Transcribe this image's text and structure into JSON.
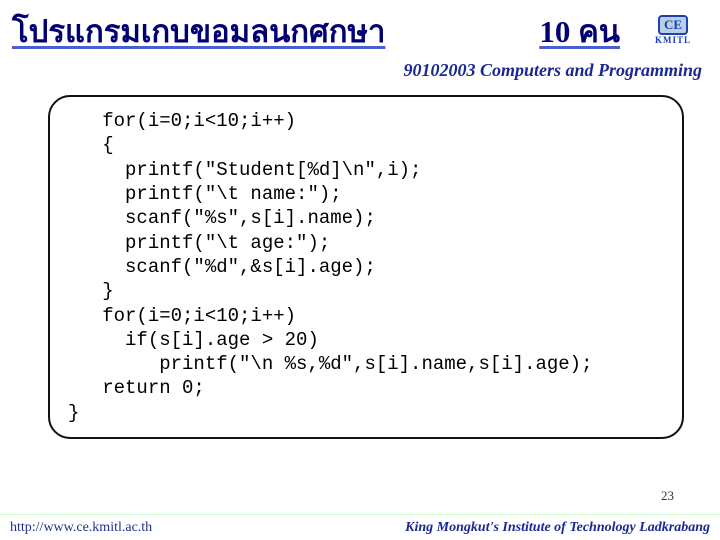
{
  "header": {
    "title_left": "โปรแกรมเกบขอมลนกศกษา",
    "title_right": "10 คน",
    "subheader": "90102003 Computers and Programming",
    "logo_top": "CE",
    "logo_bot": "KMITL"
  },
  "code": {
    "lines": [
      "   for(i=0;i<10;i++)",
      "   {",
      "     printf(\"Student[%d]\\n\",i);",
      "     printf(\"\\t name:\");",
      "     scanf(\"%s\",s[i].name);",
      "     printf(\"\\t age:\");",
      "     scanf(\"%d\",&s[i].age);",
      "   }",
      "   for(i=0;i<10;i++)",
      "     if(s[i].age > 20)",
      "        printf(\"\\n %s,%d\",s[i].name,s[i].age);",
      "   return 0;",
      "}"
    ]
  },
  "page_number": "23",
  "footer": {
    "url": "http://www.ce.kmitl.ac.th",
    "org": "King Mongkut's Institute of Technology Ladkrabang"
  }
}
